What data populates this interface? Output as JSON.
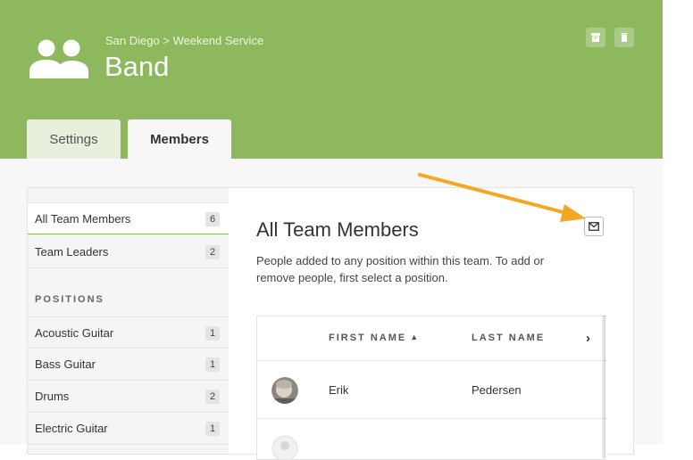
{
  "header": {
    "breadcrumb": "San Diego > Weekend Service",
    "title": "Band",
    "team_icon": "people-icon",
    "archive_icon": "archive-icon",
    "delete_icon": "trash-icon",
    "background_color": "#8db85e"
  },
  "tabs": [
    {
      "label": "Settings",
      "active": false
    },
    {
      "label": "Members",
      "active": true
    }
  ],
  "sidebar": {
    "items": [
      {
        "label": "All Team Members",
        "count": "6",
        "active": true
      },
      {
        "label": "Team Leaders",
        "count": "2",
        "active": false
      }
    ],
    "positions_label": "POSITIONS",
    "positions": [
      {
        "label": "Acoustic Guitar",
        "count": "1"
      },
      {
        "label": "Bass Guitar",
        "count": "1"
      },
      {
        "label": "Drums",
        "count": "2"
      },
      {
        "label": "Electric Guitar",
        "count": "1"
      }
    ]
  },
  "main": {
    "title": "All Team Members",
    "description": "People added to any position within this team. To add or remove people, first select a position.",
    "email_icon": "envelope-icon"
  },
  "table": {
    "columns": [
      "FIRST NAME",
      "LAST NAME"
    ],
    "sort_column": "FIRST NAME",
    "sort_direction": "ascending",
    "rows": [
      {
        "first_name": "Erik",
        "last_name": "Pedersen"
      }
    ]
  },
  "annotation": {
    "arrow_color": "#f5a623"
  }
}
